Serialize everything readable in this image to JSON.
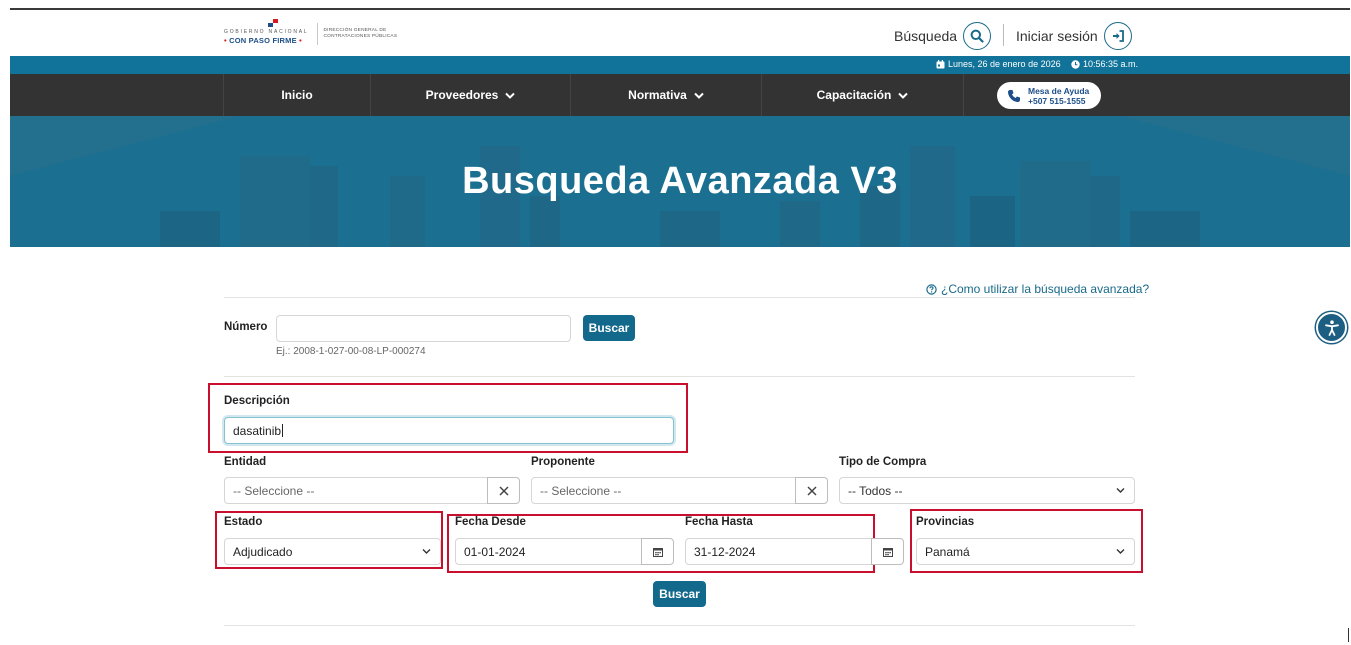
{
  "header": {
    "logo": {
      "line1": "GOBIERNO NACIONAL",
      "line2": "CON PASO FIRME",
      "dg_line1": "DIRECCIÓN GENERAL DE",
      "dg_line2": "CONTRATACIONES PÚBLICAS"
    },
    "search_label": "Búsqueda",
    "login_label": "Iniciar sesión"
  },
  "datebar": {
    "date": "Lunes, 26 de enero de 2026",
    "time": "10:56:35 a.m."
  },
  "nav": {
    "items": [
      {
        "label": "Inicio"
      },
      {
        "label": "Proveedores"
      },
      {
        "label": "Normativa"
      },
      {
        "label": "Capacitación"
      }
    ],
    "help": {
      "line1": "Mesa de Ayuda",
      "line2": "+507 515-1555"
    }
  },
  "banner": {
    "title": "Busqueda Avanzada V3"
  },
  "form": {
    "howto_link": "¿Como utilizar la búsqueda avanzada?",
    "numero": {
      "label": "Número",
      "value": "",
      "hint": "Ej.: 2008-1-027-00-08-LP-000274",
      "button": "Buscar"
    },
    "descripcion": {
      "label": "Descripción",
      "value": "dasatinib"
    },
    "entidad": {
      "label": "Entidad",
      "value": "-- Seleccione --"
    },
    "proponente": {
      "label": "Proponente",
      "value": "-- Seleccione --"
    },
    "tipo_compra": {
      "label": "Tipo de Compra",
      "value": "-- Todos --"
    },
    "estado": {
      "label": "Estado",
      "value": "Adjudicado"
    },
    "fecha_desde": {
      "label": "Fecha Desde",
      "value": "01-01-2024"
    },
    "fecha_hasta": {
      "label": "Fecha Hasta",
      "value": "31-12-2024"
    },
    "provincias": {
      "label": "Provincias",
      "value": "Panamá"
    },
    "submit": "Buscar"
  },
  "colors": {
    "teal": "#117399",
    "nav_bg": "#333333",
    "button": "#13698b",
    "highlight": "#c8102e"
  }
}
